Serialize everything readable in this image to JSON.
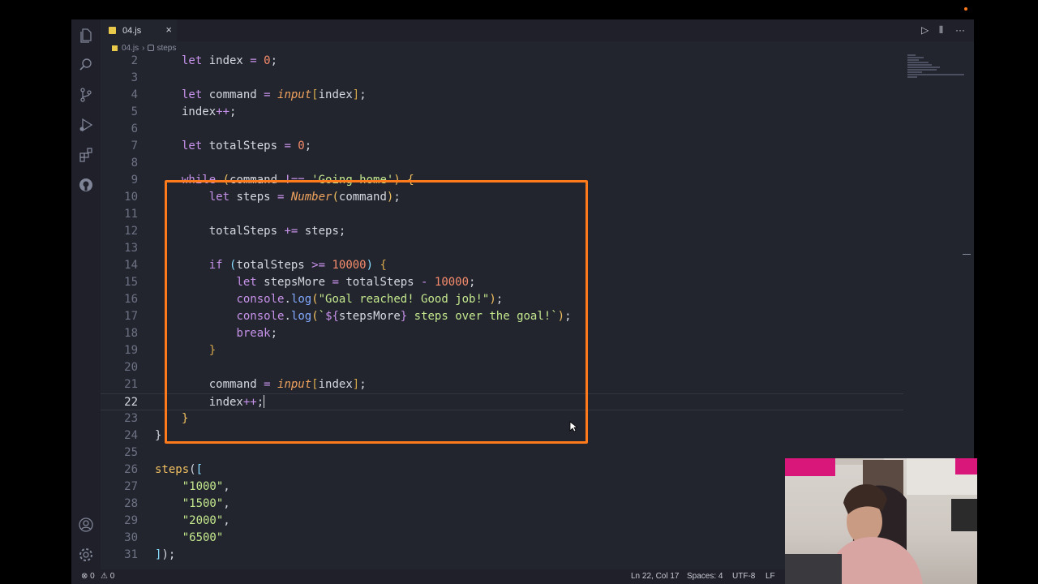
{
  "tab": {
    "filename": "04.js",
    "close": "×"
  },
  "breadcrumb": {
    "file": "04.js",
    "separator": "›",
    "symbol": "steps"
  },
  "editor_actions": {
    "run": "▷",
    "split": "⫴",
    "more": "···"
  },
  "code_lines": [
    {
      "n": "2",
      "tokens": [
        [
          "kw",
          "let "
        ],
        [
          "var",
          "index "
        ],
        [
          "op",
          "= "
        ],
        [
          "num",
          "0"
        ],
        [
          "var",
          ";"
        ]
      ]
    },
    {
      "n": "3",
      "tokens": []
    },
    {
      "n": "4",
      "tokens": [
        [
          "kw",
          "let "
        ],
        [
          "var",
          "command "
        ],
        [
          "op",
          "= "
        ],
        [
          "it",
          "input"
        ],
        [
          "br",
          "["
        ],
        [
          "var",
          "index"
        ],
        [
          "br",
          "]"
        ],
        [
          "var",
          ";"
        ]
      ]
    },
    {
      "n": "5",
      "tokens": [
        [
          "var",
          "index"
        ],
        [
          "op",
          "++"
        ],
        [
          "var",
          ";"
        ]
      ]
    },
    {
      "n": "6",
      "tokens": []
    },
    {
      "n": "7",
      "tokens": [
        [
          "kw",
          "let "
        ],
        [
          "var",
          "totalSteps "
        ],
        [
          "op",
          "= "
        ],
        [
          "num",
          "0"
        ],
        [
          "var",
          ";"
        ]
      ]
    },
    {
      "n": "8",
      "tokens": []
    },
    {
      "n": "9",
      "tokens": [
        [
          "ctrl",
          "while "
        ],
        [
          "gold",
          "("
        ],
        [
          "var",
          "command "
        ],
        [
          "op",
          "!== "
        ],
        [
          "str",
          "'Going home'"
        ],
        [
          "gold",
          ") "
        ],
        [
          "gold",
          "{"
        ]
      ]
    },
    {
      "n": "10",
      "tokens": [
        [
          "var",
          "    "
        ],
        [
          "kw",
          "let "
        ],
        [
          "var",
          "steps "
        ],
        [
          "op",
          "= "
        ],
        [
          "it",
          "Number"
        ],
        [
          "gold",
          "("
        ],
        [
          "var",
          "command"
        ],
        [
          "gold",
          ")"
        ],
        [
          "var",
          ";"
        ]
      ]
    },
    {
      "n": "11",
      "tokens": []
    },
    {
      "n": "12",
      "tokens": [
        [
          "var",
          "    totalSteps "
        ],
        [
          "op",
          "+= "
        ],
        [
          "var",
          "steps;"
        ]
      ]
    },
    {
      "n": "13",
      "tokens": []
    },
    {
      "n": "14",
      "tokens": [
        [
          "var",
          "    "
        ],
        [
          "ctrl",
          "if "
        ],
        [
          "cyan",
          "("
        ],
        [
          "var",
          "totalSteps "
        ],
        [
          "op",
          ">= "
        ],
        [
          "num",
          "10000"
        ],
        [
          "cyan",
          ") "
        ],
        [
          "br",
          "{"
        ]
      ]
    },
    {
      "n": "15",
      "tokens": [
        [
          "var",
          "        "
        ],
        [
          "kw",
          "let "
        ],
        [
          "var",
          "stepsMore "
        ],
        [
          "op",
          "= "
        ],
        [
          "var",
          "totalSteps "
        ],
        [
          "op",
          "- "
        ],
        [
          "num",
          "10000"
        ],
        [
          "var",
          ";"
        ]
      ]
    },
    {
      "n": "16",
      "tokens": [
        [
          "var",
          "        "
        ],
        [
          "kw",
          "console"
        ],
        [
          "var",
          "."
        ],
        [
          "fn",
          "log"
        ],
        [
          "gold",
          "("
        ],
        [
          "str",
          "\"Goal reached! Good job!\""
        ],
        [
          "gold",
          ")"
        ],
        [
          "var",
          ";"
        ]
      ]
    },
    {
      "n": "17",
      "tokens": [
        [
          "var",
          "        "
        ],
        [
          "kw",
          "console"
        ],
        [
          "var",
          "."
        ],
        [
          "fn",
          "log"
        ],
        [
          "gold",
          "("
        ],
        [
          "str",
          "`"
        ],
        [
          "kw",
          "${"
        ],
        [
          "var",
          "stepsMore"
        ],
        [
          "kw",
          "}"
        ],
        [
          "str",
          " steps over the goal!`"
        ],
        [
          "gold",
          ")"
        ],
        [
          "var",
          ";"
        ]
      ]
    },
    {
      "n": "18",
      "tokens": [
        [
          "var",
          "        "
        ],
        [
          "ctrl",
          "break"
        ],
        [
          "var",
          ";"
        ]
      ]
    },
    {
      "n": "19",
      "tokens": [
        [
          "var",
          "    "
        ],
        [
          "br",
          "}"
        ]
      ]
    },
    {
      "n": "20",
      "tokens": []
    },
    {
      "n": "21",
      "tokens": [
        [
          "var",
          "    command "
        ],
        [
          "op",
          "= "
        ],
        [
          "it",
          "input"
        ],
        [
          "br",
          "["
        ],
        [
          "var",
          "index"
        ],
        [
          "br",
          "]"
        ],
        [
          "var",
          ";"
        ]
      ]
    },
    {
      "n": "22",
      "tokens": [
        [
          "var",
          "    index"
        ],
        [
          "op",
          "++"
        ],
        [
          "var",
          ";"
        ]
      ],
      "current": true
    },
    {
      "n": "23",
      "tokens": [
        [
          "gold",
          "}"
        ]
      ]
    },
    {
      "n": "24",
      "tokens": [
        [
          "var",
          "}"
        ]
      ],
      "outdent": true
    },
    {
      "n": "25",
      "tokens": []
    },
    {
      "n": "26",
      "tokens": [
        [
          "gold",
          "steps"
        ],
        [
          "var",
          "("
        ],
        [
          "cyan",
          "["
        ]
      ],
      "outdent": true
    },
    {
      "n": "27",
      "tokens": [
        [
          "var",
          "    "
        ],
        [
          "str",
          "\"1000\""
        ],
        [
          "var",
          ","
        ]
      ],
      "outdent": true
    },
    {
      "n": "28",
      "tokens": [
        [
          "var",
          "    "
        ],
        [
          "str",
          "\"1500\""
        ],
        [
          "var",
          ","
        ]
      ],
      "outdent": true
    },
    {
      "n": "29",
      "tokens": [
        [
          "var",
          "    "
        ],
        [
          "str",
          "\"2000\""
        ],
        [
          "var",
          ","
        ]
      ],
      "outdent": true
    },
    {
      "n": "30",
      "tokens": [
        [
          "var",
          "    "
        ],
        [
          "str",
          "\"6500\""
        ]
      ],
      "outdent": true
    },
    {
      "n": "31",
      "tokens": [
        [
          "cyan",
          "]"
        ],
        [
          "var",
          ");"
        ]
      ],
      "outdent": true
    }
  ],
  "status": {
    "errors": "⊗ 0",
    "warnings": "⚠ 0",
    "position": "Ln 22, Col 17",
    "spaces": "Spaces: 4",
    "encoding": "UTF-8",
    "eol": "LF"
  },
  "colors": {
    "highlight_box": "#ff7a1a",
    "editor_bg": "#23252e"
  },
  "icons": [
    "files-icon",
    "search-icon",
    "source-control-icon",
    "run-debug-icon",
    "extensions-icon",
    "github-icon",
    "account-icon",
    "settings-gear-icon"
  ]
}
